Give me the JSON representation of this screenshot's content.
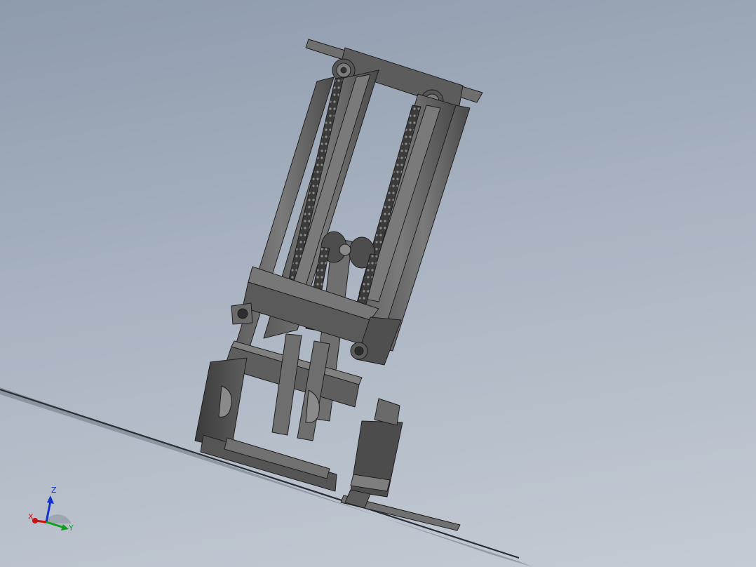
{
  "viewport": {
    "model": "forklift-mast-assembly",
    "view_style": "shaded-with-edges"
  },
  "colors": {
    "background_top": "#8e9bad",
    "background_bottom": "#c5cbd4",
    "metal_dark": "#4a4a4a",
    "metal_mid": "#6b6b6b",
    "metal_light": "#8a8a8a",
    "edge": "#1e1e1e",
    "axis_x": "#cc1010",
    "axis_y": "#10a020",
    "axis_z": "#1030d0"
  },
  "triad": {
    "x_label": "X",
    "y_label": "Y",
    "z_label": "Z"
  }
}
